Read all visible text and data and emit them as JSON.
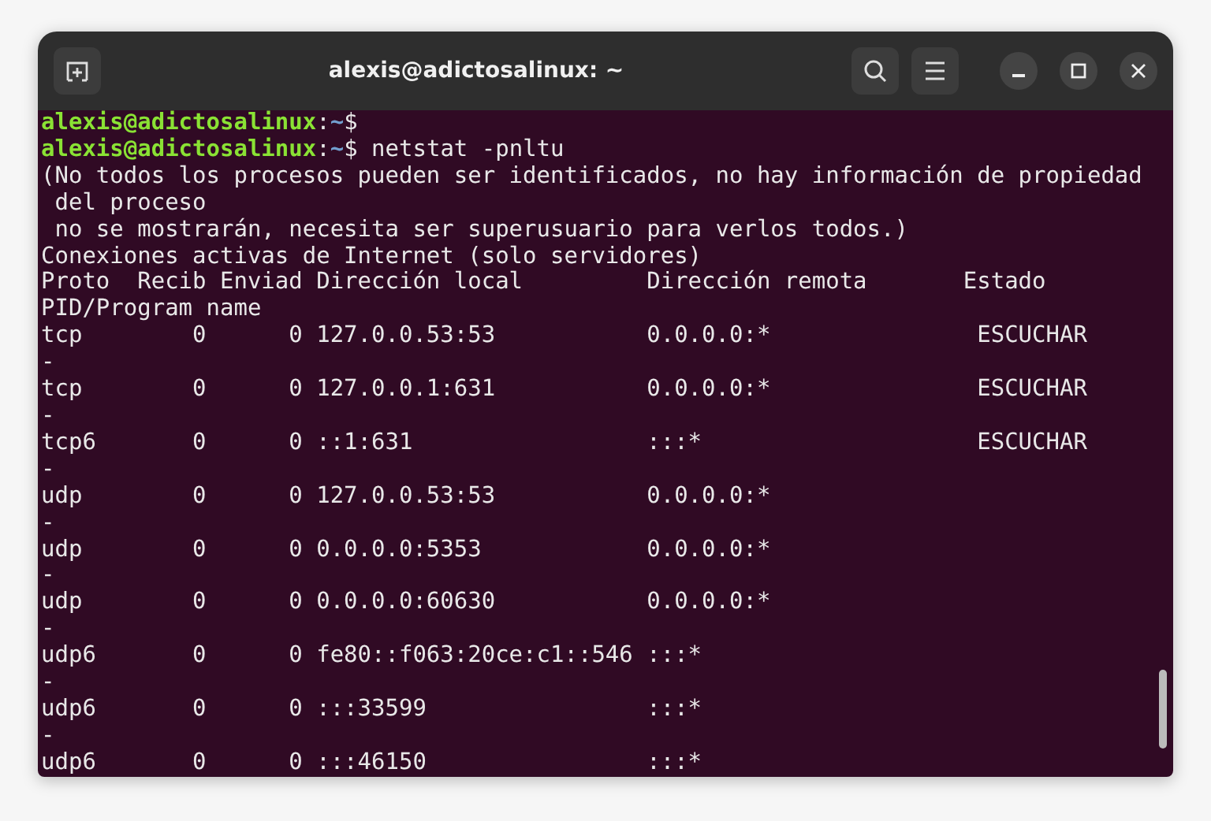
{
  "window": {
    "title": "alexis@adictosalinux: ~"
  },
  "terminal": {
    "lines": [
      {
        "kind": "prompt",
        "user": "alexis@adictosalinux",
        "sep": ":",
        "path": "~",
        "symbol": "$"
      },
      {
        "kind": "prompt",
        "user": "alexis@adictosalinux",
        "sep": ":",
        "path": "~",
        "symbol": "$",
        "command": " netstat -pnltu"
      },
      {
        "kind": "output",
        "text": "(No todos los procesos pueden ser identificados, no hay información de propiedad"
      },
      {
        "kind": "output",
        "text": " del proceso"
      },
      {
        "kind": "output",
        "text": " no se mostrarán, necesita ser superusuario para verlos todos.)"
      },
      {
        "kind": "output",
        "text": "Conexiones activas de Internet (solo servidores)"
      },
      {
        "kind": "output",
        "text": "Proto  Recib Enviad Dirección local         Dirección remota       Estado"
      },
      {
        "kind": "output",
        "text": "PID/Program name"
      },
      {
        "kind": "output",
        "text": "tcp        0      0 127.0.0.53:53           0.0.0.0:*               ESCUCHAR"
      },
      {
        "kind": "output",
        "text": "-"
      },
      {
        "kind": "output",
        "text": "tcp        0      0 127.0.0.1:631           0.0.0.0:*               ESCUCHAR"
      },
      {
        "kind": "output",
        "text": "-"
      },
      {
        "kind": "output",
        "text": "tcp6       0      0 ::1:631                 :::*                    ESCUCHAR"
      },
      {
        "kind": "output",
        "text": "-"
      },
      {
        "kind": "output",
        "text": "udp        0      0 127.0.0.53:53           0.0.0.0:*"
      },
      {
        "kind": "output",
        "text": "-"
      },
      {
        "kind": "output",
        "text": "udp        0      0 0.0.0.0:5353            0.0.0.0:*"
      },
      {
        "kind": "output",
        "text": "-"
      },
      {
        "kind": "output",
        "text": "udp        0      0 0.0.0.0:60630           0.0.0.0:*"
      },
      {
        "kind": "output",
        "text": "-"
      },
      {
        "kind": "output",
        "text": "udp6       0      0 fe80::f063:20ce:c1::546 :::*"
      },
      {
        "kind": "output",
        "text": "-"
      },
      {
        "kind": "output",
        "text": "udp6       0      0 :::33599                :::*"
      },
      {
        "kind": "output",
        "text": "-"
      },
      {
        "kind": "output",
        "text": "udp6       0      0 :::46150                :::*"
      }
    ]
  }
}
